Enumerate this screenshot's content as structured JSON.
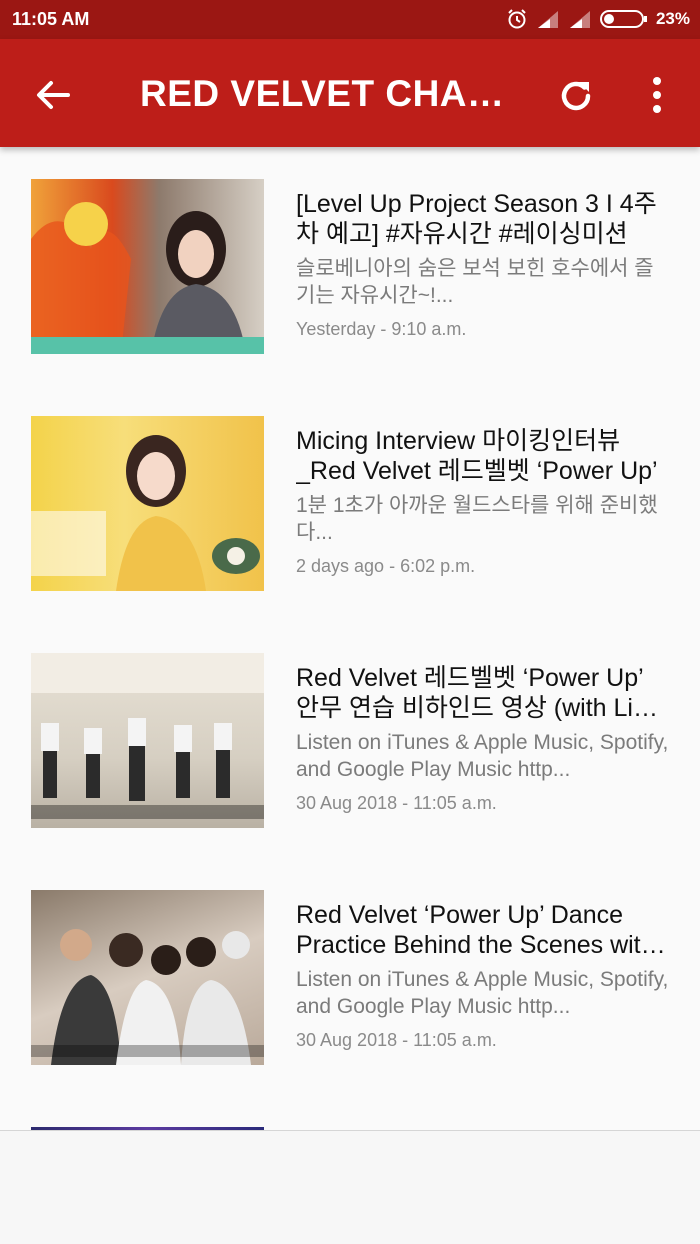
{
  "status_bar": {
    "time": "11:05 AM",
    "battery_percent": "23%",
    "icons": [
      "alarm-icon",
      "signal-icon",
      "signal-icon",
      "battery-icon"
    ]
  },
  "app_bar": {
    "title": "RED VELVET CHANNEL",
    "background_color": "#bd1e19",
    "icons": [
      "back-arrow-icon",
      "refresh-icon",
      "more-vert-icon"
    ]
  },
  "videos": [
    {
      "title": "[Level Up Project Season 3 I 4주차 예고] #자유시간 #레이싱미션",
      "description": "슬로베니아의 숨은 보석 보힌 호수에서 즐기는 자유시간~!...",
      "date": "Yesterday - 9:10 a.m."
    },
    {
      "title": "Micing Interview 마이킹인터뷰_Red Velvet 레드벨벳 ‘Power Up’",
      "description": "1분 1초가 아까운 월드스타를 위해 준비했다...",
      "date": "2 days ago - 6:02 p.m."
    },
    {
      "title": "Red Velvet 레드벨벳 ‘Power Up’ 안무 연습 비하인드 영상 (with Lia Kim)",
      "description": "Listen on iTunes & Apple Music, Spotify, and Google Play Music http...",
      "date": "30 Aug 2018 - 11:05 a.m."
    },
    {
      "title": "Red Velvet ‘Power Up’ Dance Practice Behind the Scenes with Lia Kim",
      "description": "Listen on iTunes & Apple Music, Spotify, and Google Play Music http...",
      "date": "30 Aug 2018 - 11:05 a.m."
    }
  ]
}
